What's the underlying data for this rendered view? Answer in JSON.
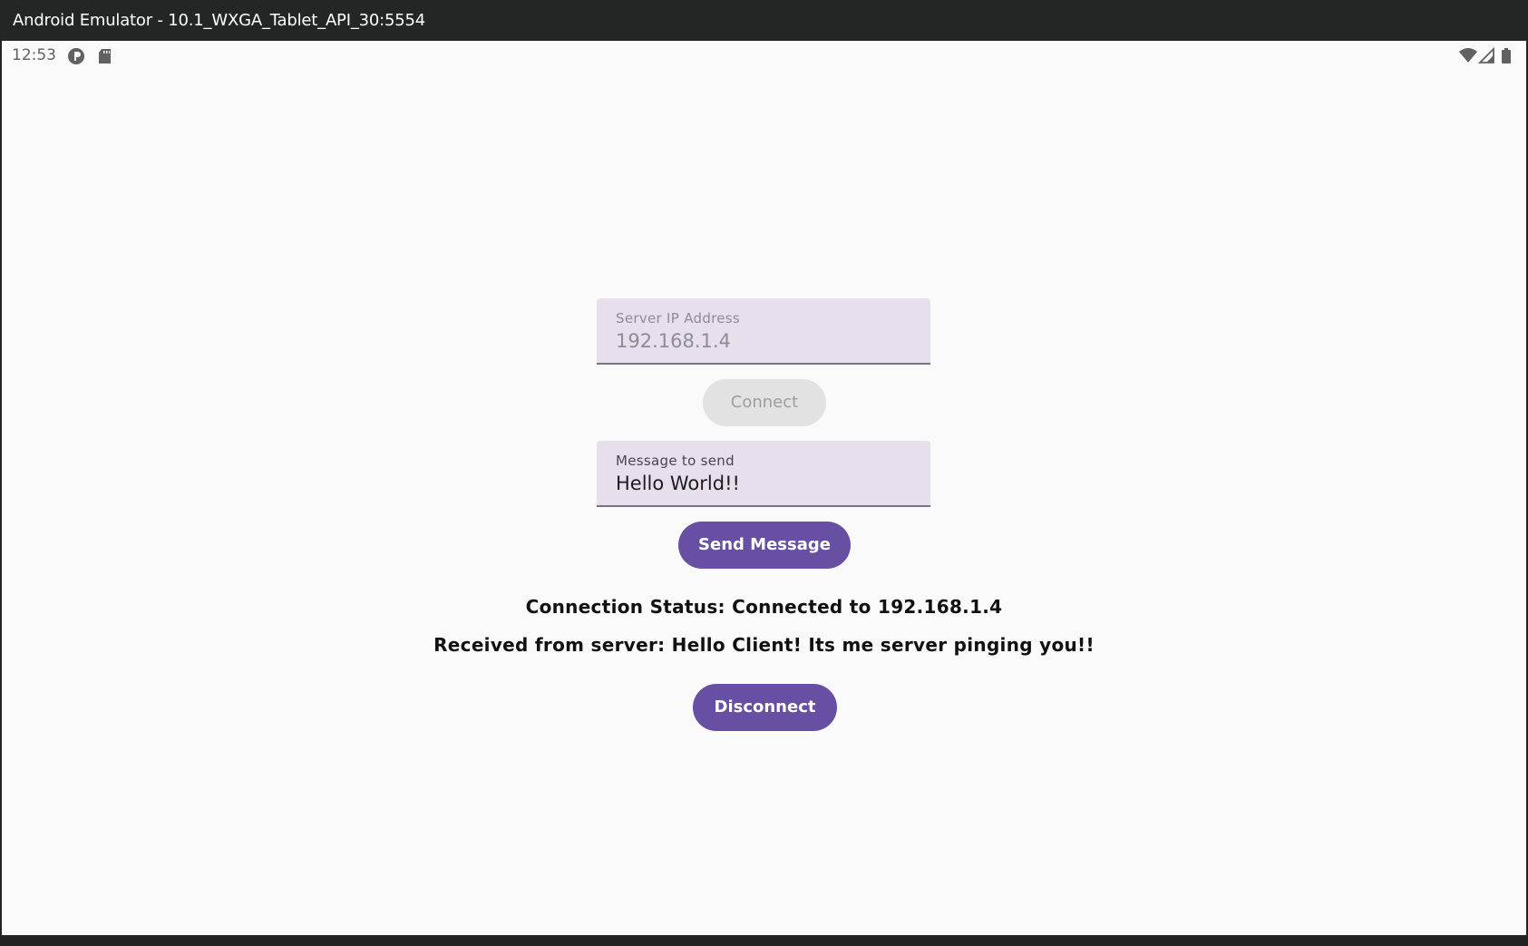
{
  "window": {
    "title": "Android Emulator - 10.1_WXGA_Tablet_API_30:5554"
  },
  "statusbar": {
    "time": "12:53",
    "left_icons": [
      "notification-circle-icon",
      "sd-card-icon"
    ],
    "right_icons": [
      "wifi-icon",
      "cell-signal-icon",
      "battery-icon"
    ]
  },
  "server_field": {
    "label": "Server IP Address",
    "value": "192.168.1.4",
    "enabled": false
  },
  "connect_button": {
    "label": "Connect",
    "enabled": false
  },
  "message_field": {
    "label": "Message to send",
    "value": "Hello World!!"
  },
  "send_button": {
    "label": "Send Message"
  },
  "connection_status": "Connection Status: Connected to 192.168.1.4",
  "received_message": "Received from server: Hello Client! Its me server pinging you!!",
  "disconnect_button": {
    "label": "Disconnect"
  },
  "colors": {
    "primary": "#6750a4",
    "field_bg": "#e7e0ec",
    "screen_bg": "#fafafa"
  }
}
